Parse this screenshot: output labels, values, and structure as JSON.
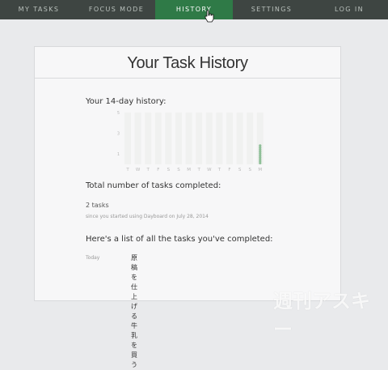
{
  "nav": {
    "items": [
      {
        "label": "MY TASKS",
        "active": false
      },
      {
        "label": "FOCUS MODE",
        "active": false
      },
      {
        "label": "HISTORY",
        "active": true
      },
      {
        "label": "SETTINGS",
        "active": false
      },
      {
        "label": "LOG IN",
        "active": false
      }
    ]
  },
  "page": {
    "title": "Your Task History",
    "history_label": "Your 14-day history:",
    "total_label": "Total number of tasks completed:",
    "total_count": "2 tasks",
    "since_text": "since you started using Dayboard on July 28, 2014",
    "list_label": "Here's a list of all the tasks you've completed:",
    "tasks": {
      "date": "Today",
      "items": [
        "原稿を仕上げる",
        "牛乳を買う"
      ]
    },
    "watermark": "週刊アスキー"
  },
  "chart_data": {
    "type": "bar",
    "title": "",
    "categories": [
      "T",
      "W",
      "T",
      "F",
      "S",
      "S",
      "M",
      "T",
      "W",
      "T",
      "F",
      "S",
      "S",
      "M"
    ],
    "values": [
      0,
      0,
      0,
      0,
      0,
      0,
      0,
      0,
      0,
      0,
      0,
      0,
      0,
      2
    ],
    "yticks": [
      1,
      3,
      5
    ],
    "ylim": [
      0,
      5
    ],
    "colors": {
      "track": "#f0f1f0",
      "dot": "#8fbf98",
      "axis": "#b8b8b8"
    }
  }
}
